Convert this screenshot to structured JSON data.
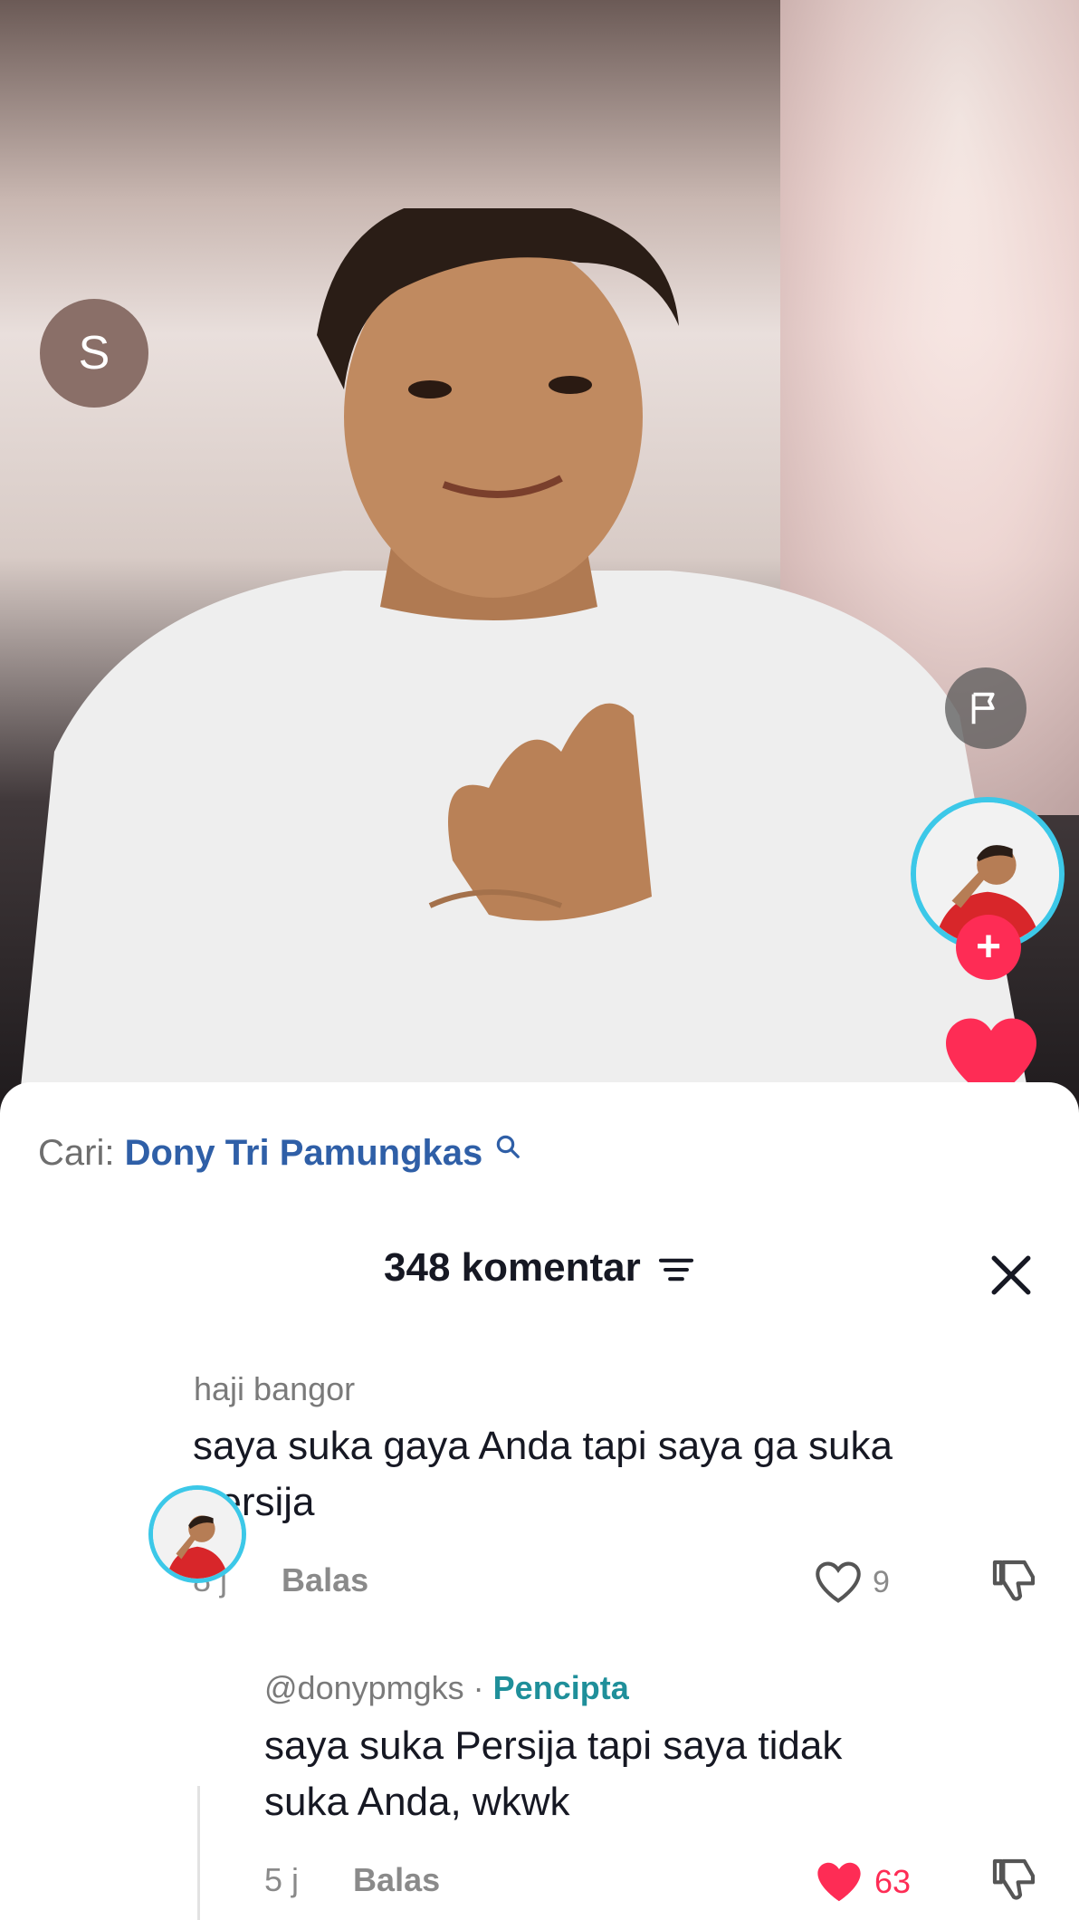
{
  "search": {
    "prefix": "Cari:",
    "query": "Dony Tri Pamungkas"
  },
  "comments_header": {
    "count_label": "348 komentar"
  },
  "comments": [
    {
      "avatar_letter": "S",
      "username": "haji bangor",
      "text_line1": "saya suka gaya Anda tapi saya ga suka",
      "text_line2": "Persija",
      "time": "8 j",
      "reply_label": "Balas",
      "likes": "9",
      "liked": false
    },
    {
      "username": "@donypmgks",
      "separator": "·",
      "badge": "Pencipta",
      "text_line1": "saya suka Persija tapi saya tidak",
      "text_line2": "suka Anda, wkwk",
      "time": "5 j",
      "reply_label": "Balas",
      "likes": "63",
      "liked": true
    }
  ],
  "colors": {
    "accent": "#fe2c55",
    "ring": "#3cc8e8",
    "link": "#2f5fa7",
    "creator": "#1f8f9a"
  },
  "icons": [
    "flag-icon",
    "plus-icon",
    "heart-icon",
    "search-icon",
    "sort-icon",
    "close-icon",
    "dislike-icon"
  ]
}
